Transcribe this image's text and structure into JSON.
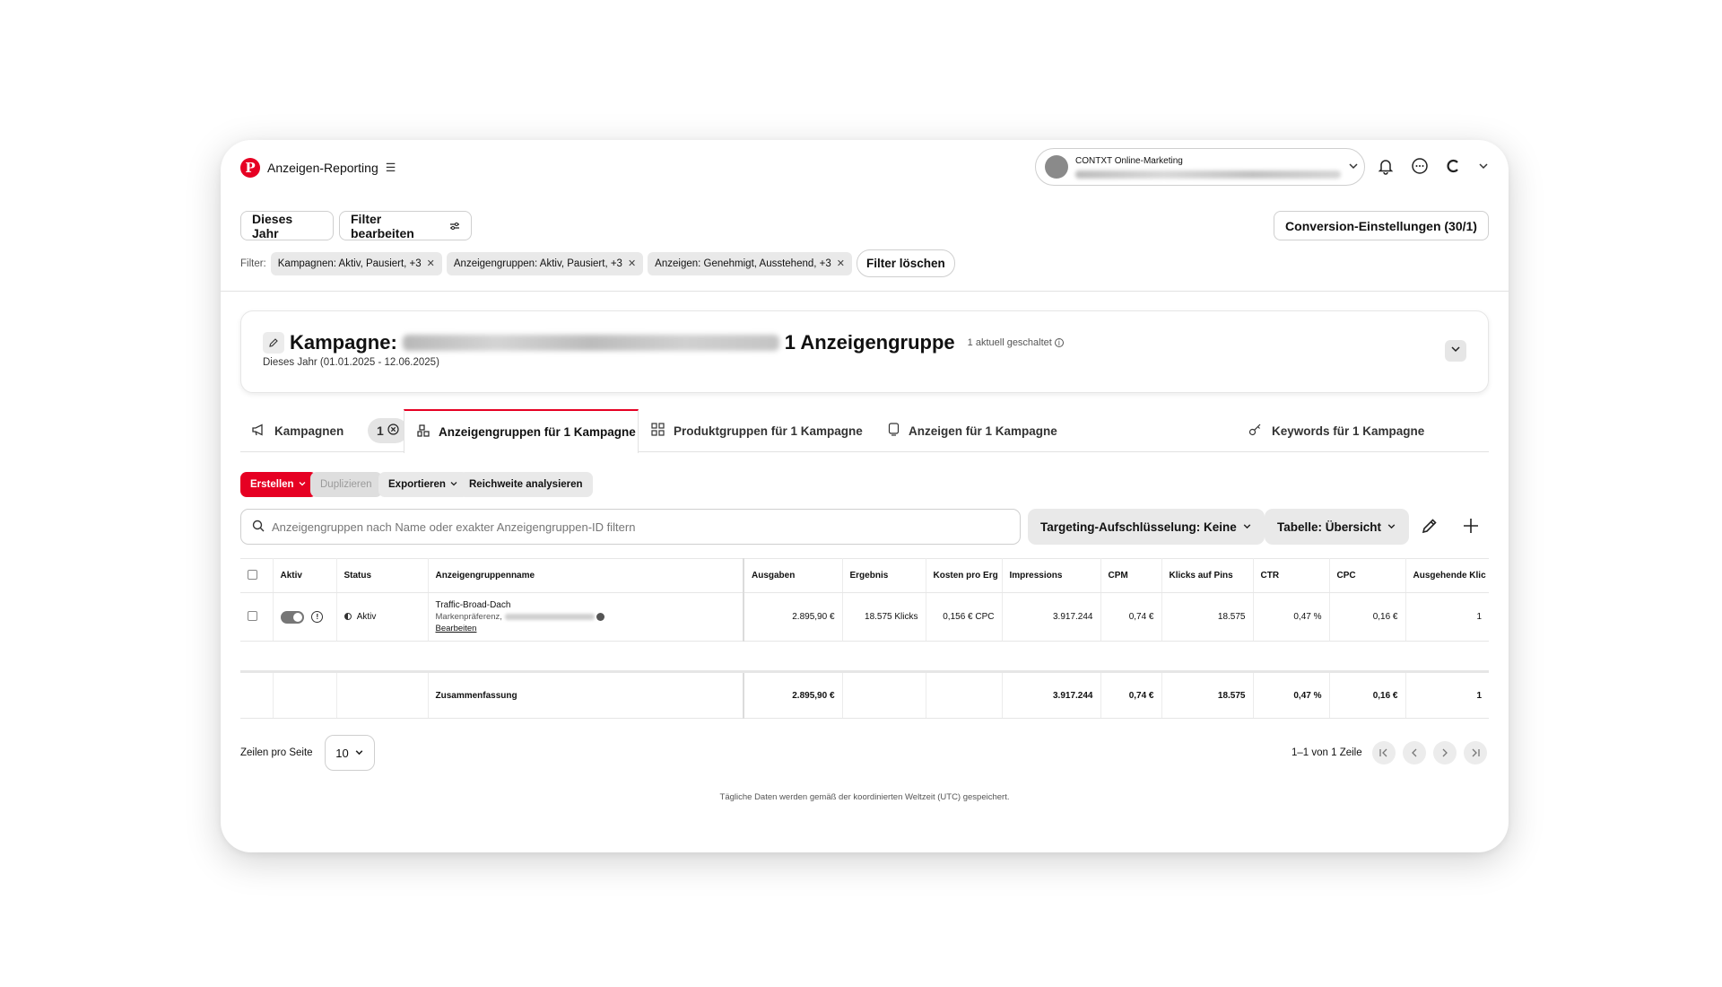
{
  "app": {
    "title": "Anzeigen-Reporting",
    "account_name": "CONTXT Online-Marketing"
  },
  "toolbar": {
    "date_range": "Dieses Jahr",
    "edit_filters": "Filter bearbeiten",
    "conversion_settings": "Conversion-Einstellungen (30/1)"
  },
  "filters": {
    "label": "Filter:",
    "chips": [
      "Kampagnen: Aktiv, Pausiert, +3",
      "Anzeigengruppen: Aktiv, Pausiert, +3",
      "Anzeigen: Genehmigt, Ausstehend, +3"
    ],
    "clear": "Filter löschen"
  },
  "campaign": {
    "prefix": "Kampagne:",
    "suffix": "1 Anzeigengruppe",
    "live_note": "1 aktuell geschaltet",
    "date_line": "Dieses Jahr (01.01.2025 - 12.06.2025)"
  },
  "tabs": [
    {
      "label": "Kampagnen",
      "count": "1"
    },
    {
      "label": "Anzeigengruppen für 1 Kampagne"
    },
    {
      "label": "Produktgruppen für 1 Kampagne"
    },
    {
      "label": "Anzeigen für 1 Kampagne"
    },
    {
      "label": "Keywords für 1 Kampagne"
    }
  ],
  "actions": {
    "create": "Erstellen",
    "duplicate": "Duplizieren",
    "export": "Exportieren",
    "reach": "Reichweite analysieren"
  },
  "search": {
    "placeholder": "Anzeigengruppen nach Name oder exakter Anzeigengruppen-ID filtern"
  },
  "view": {
    "targeting": "Targeting-Aufschlüsselung: Keine",
    "table": "Tabelle: Übersicht"
  },
  "table": {
    "headers": [
      "Aktiv",
      "Status",
      "Anzeigengruppenname",
      "Ausgaben",
      "Ergebnis",
      "Kosten pro Erg",
      "Impressions",
      "CPM",
      "Klicks auf Pins",
      "CTR",
      "CPC",
      "Ausgehende Klic"
    ],
    "row": {
      "status": "Aktiv",
      "name": "Traffic-Broad-Dach",
      "sub": "Markenpräferenz,",
      "edit": "Bearbeiten",
      "spend": "2.895,90 €",
      "result": "18.575 Klicks",
      "cost_per_result": "0,156 € CPC",
      "impressions": "3.917.244",
      "cpm": "0,74 €",
      "pin_clicks": "18.575",
      "ctr": "0,47 %",
      "cpc": "0,16 €",
      "outbound": "1"
    },
    "summary": {
      "label": "Zusammenfassung",
      "spend": "2.895,90 €",
      "impressions": "3.917.244",
      "cpm": "0,74 €",
      "pin_clicks": "18.575",
      "ctr": "0,47 %",
      "cpc": "0,16 €",
      "outbound": "1"
    }
  },
  "pagination": {
    "rows_label": "Zeilen pro Seite",
    "rows_value": "10",
    "range": "1–1 von 1 Zeile"
  },
  "footer_note": "Tägliche Daten werden gemäß der koordinierten Weltzeit (UTC) gespeichert.",
  "colors": {
    "brand": "#e60023",
    "chip_bg": "#e9e9e9"
  }
}
